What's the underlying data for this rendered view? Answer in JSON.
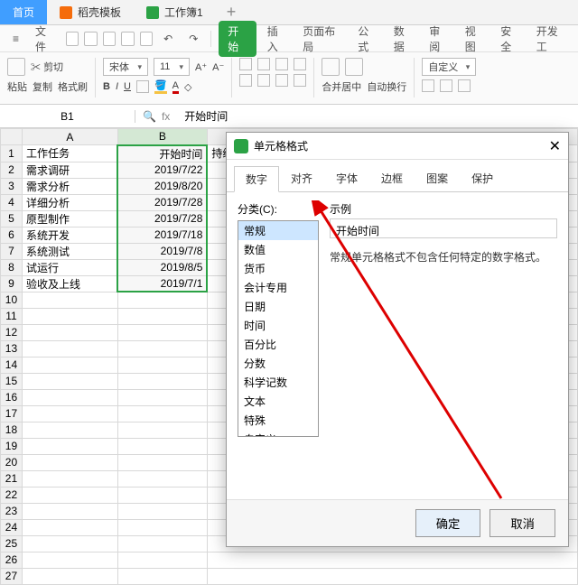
{
  "tabs": {
    "home": "首页",
    "template": "稻壳模板",
    "workbook": "工作簿1",
    "add": "+"
  },
  "file_label": "文件",
  "menu": {
    "start": "开始",
    "insert": "插入",
    "layout": "页面布局",
    "formula": "公式",
    "data": "数据",
    "review": "审阅",
    "view": "视图",
    "security": "安全",
    "dev": "开发工"
  },
  "ribbon": {
    "paste": "粘贴",
    "cut": "剪切",
    "copy": "复制",
    "format_painter": "格式刷",
    "font": "宋体",
    "font_size": "11",
    "merge": "合并居中",
    "autowrap": "自动换行",
    "custom": "自定义"
  },
  "namebox": "B1",
  "fx_value": "开始时间",
  "columns": [
    "A",
    "B"
  ],
  "col_partial": "持续",
  "rows": [
    {
      "a": "工作任务",
      "b": "开始时间"
    },
    {
      "a": "需求调研",
      "b": "2019/7/22"
    },
    {
      "a": "需求分析",
      "b": "2019/8/20"
    },
    {
      "a": "详细分析",
      "b": "2019/7/28"
    },
    {
      "a": "原型制作",
      "b": "2019/7/28"
    },
    {
      "a": "系统开发",
      "b": "2019/7/18"
    },
    {
      "a": "系统测试",
      "b": "2019/7/8"
    },
    {
      "a": "试运行",
      "b": "2019/8/5"
    },
    {
      "a": "验收及上线",
      "b": "2019/7/1"
    }
  ],
  "dialog": {
    "title": "单元格格式",
    "tabs": [
      "数字",
      "对齐",
      "字体",
      "边框",
      "图案",
      "保护"
    ],
    "category_label": "分类(C):",
    "categories": [
      "常规",
      "数值",
      "货币",
      "会计专用",
      "日期",
      "时间",
      "百分比",
      "分数",
      "科学记数",
      "文本",
      "特殊",
      "自定义"
    ],
    "sample_label": "示例",
    "sample_value": "开始时间",
    "desc": "常规单元格格式不包含任何特定的数字格式。",
    "ok": "确定",
    "cancel": "取消"
  }
}
